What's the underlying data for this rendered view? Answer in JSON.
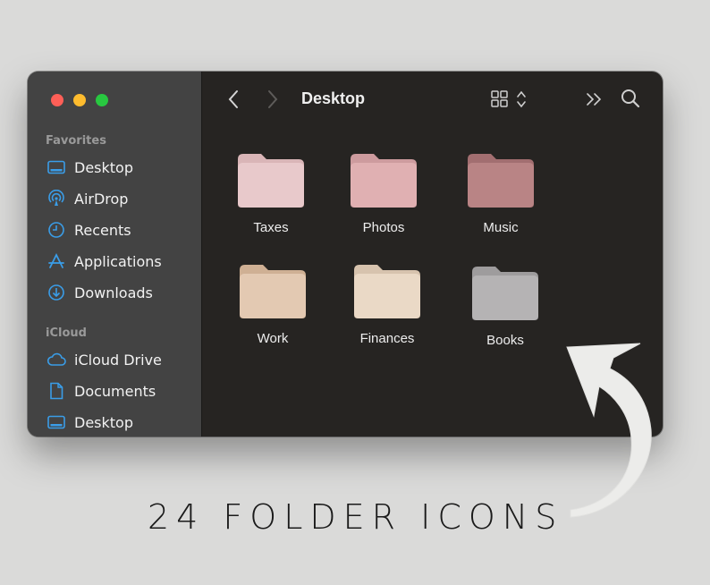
{
  "window": {
    "title": "Desktop",
    "traffic_lights": {
      "close_color": "#ff5f57",
      "minimize_color": "#febc2e",
      "zoom_color": "#28c840"
    }
  },
  "sidebar": {
    "sections": [
      {
        "title": "Favorites",
        "items": [
          {
            "label": "Desktop",
            "icon": "desktop-icon"
          },
          {
            "label": "AirDrop",
            "icon": "airdrop-icon"
          },
          {
            "label": "Recents",
            "icon": "clock-icon"
          },
          {
            "label": "Applications",
            "icon": "applications-icon"
          },
          {
            "label": "Downloads",
            "icon": "download-icon"
          }
        ]
      },
      {
        "title": "iCloud",
        "items": [
          {
            "label": "iCloud Drive",
            "icon": "cloud-icon"
          },
          {
            "label": "Documents",
            "icon": "document-icon"
          },
          {
            "label": "Desktop",
            "icon": "desktop-icon"
          }
        ]
      }
    ],
    "icon_color": "#3a9de8"
  },
  "toolbar": {
    "back_icon": "chevron-left-icon",
    "forward_icon": "chevron-right-icon",
    "view_icon": "grid-view-icon",
    "more_icon": "double-chevron-icon",
    "search_icon": "search-icon"
  },
  "folders": [
    {
      "name": "Taxes",
      "color": "#e8c9cb",
      "tab": "#d9b5b7"
    },
    {
      "name": "Photos",
      "color": "#e0b0b2",
      "tab": "#cd9b9e"
    },
    {
      "name": "Music",
      "color": "#b98485",
      "tab": "#a26e70"
    },
    {
      "name": "Work",
      "color": "#e3c9b2",
      "tab": "#cfb094"
    },
    {
      "name": "Finances",
      "color": "#ead9c6",
      "tab": "#d7c3ae"
    },
    {
      "name": "Books",
      "color": "#b5b3b4",
      "tab": "#9e9c9d"
    }
  ],
  "caption": "24 FOLDER ICONS"
}
